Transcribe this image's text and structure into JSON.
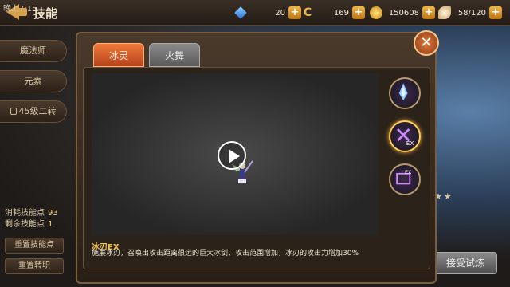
{
  "status": {
    "time": "晚上7:15"
  },
  "header": {
    "title": "技能",
    "resources": [
      {
        "icon": "diamond-icon",
        "value": "20"
      },
      {
        "icon": "c-coin-icon",
        "value": "169"
      },
      {
        "icon": "gold-coin-icon",
        "value": "150608"
      },
      {
        "icon": "wing-icon",
        "value": "58/120"
      }
    ]
  },
  "sidebar": {
    "items": [
      {
        "label": "魔法师"
      },
      {
        "label": "元素"
      },
      {
        "label": "45级二转"
      }
    ],
    "stats": [
      {
        "label": "消耗技能点",
        "value": "93"
      },
      {
        "label": "剩余技能点",
        "value": "1"
      }
    ],
    "buttons": [
      {
        "label": "重置技能点"
      },
      {
        "label": "重置转职"
      }
    ]
  },
  "modal": {
    "tabs": [
      {
        "label": "冰灵"
      },
      {
        "label": "火舞"
      }
    ],
    "skill_name": "冰刃EX",
    "skill_desc": "施展冰刃，召唤出攻击距离很远的巨大冰剑，攻击范围增加，冰刃的攻击力增加30%",
    "skills": [
      {
        "icon": "ice-crystal-skill-icon"
      },
      {
        "icon": "ice-blade-ex-skill-icon",
        "selected": true
      },
      {
        "icon": "ice-shield-ex-skill-icon"
      }
    ]
  },
  "right": {
    "accept_label": "接受试炼"
  }
}
